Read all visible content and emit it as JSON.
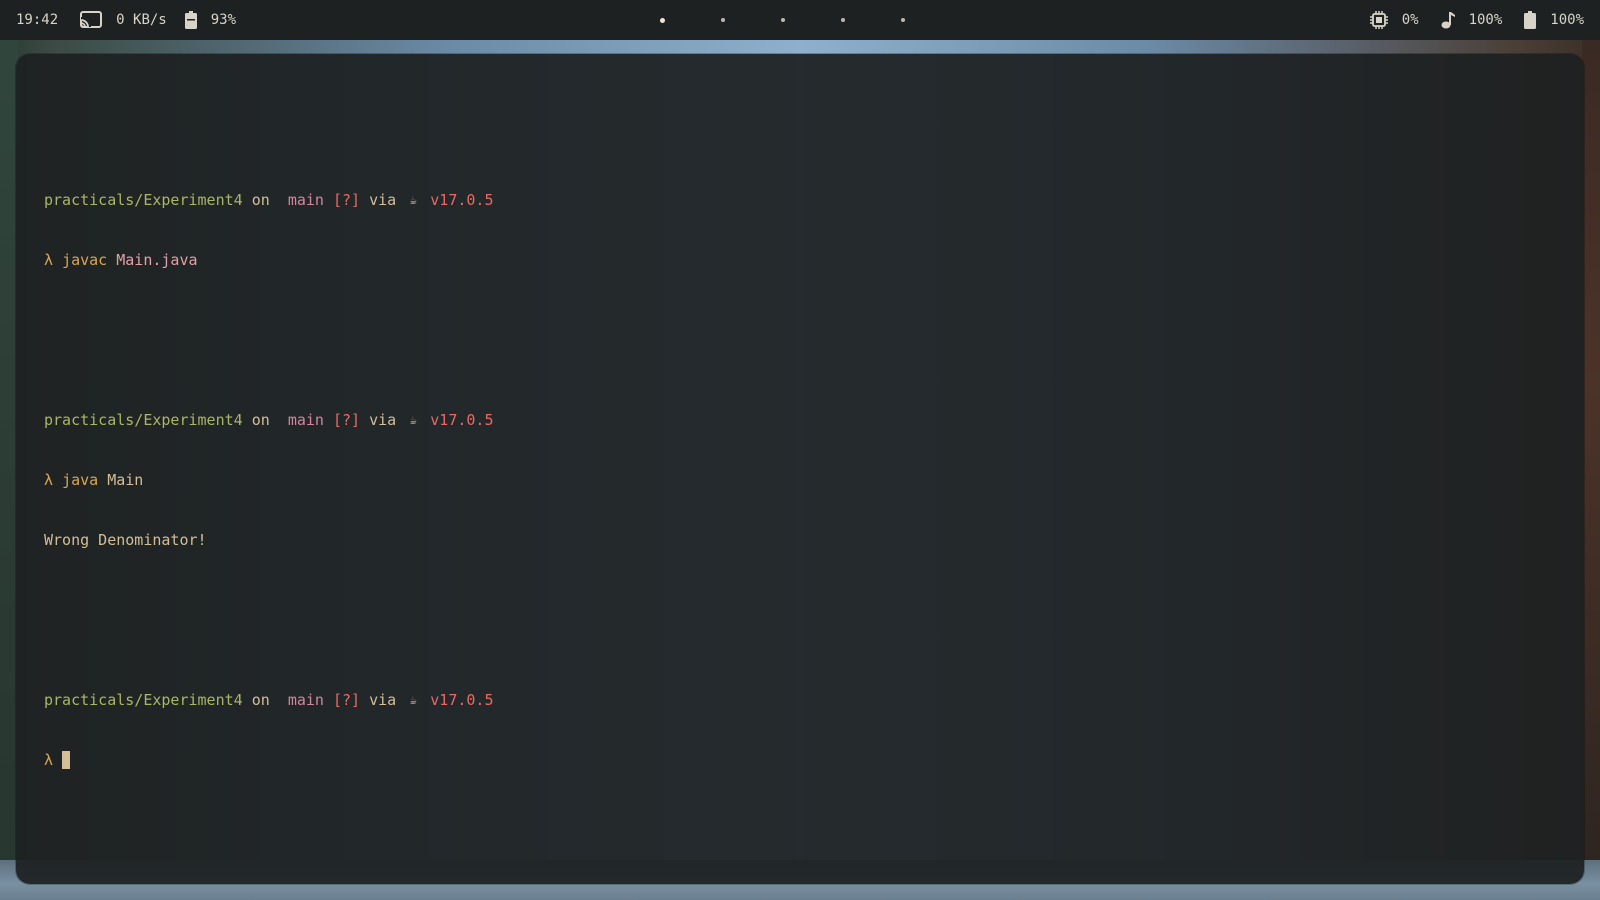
{
  "topbar": {
    "clock": "19:42",
    "network_speed": "0 KB/s",
    "battery_left": "93%",
    "workspaces": [
      {
        "active": true
      },
      {
        "active": false
      },
      {
        "active": false
      },
      {
        "active": false
      },
      {
        "active": false
      }
    ],
    "cpu": "0%",
    "volume": "100%",
    "battery_right": "100%"
  },
  "terminal": {
    "prompt": {
      "path": "practicals/Experiment4",
      "on": "on",
      "branch_icon": "",
      "branch": "main",
      "status": "[?]",
      "via": "via",
      "java_icon": "☕",
      "java_version": "v17.0.5",
      "lambda": "λ"
    },
    "blocks": [
      {
        "cmd": "javac",
        "arg": "Main.java",
        "output": ""
      },
      {
        "cmd": "java",
        "arg": "Main",
        "output": "Wrong Denominator!"
      },
      {
        "cmd": "",
        "arg": "",
        "output": ""
      }
    ]
  },
  "colors": {
    "bar_bg": "#1e2122",
    "terminal_bg": "#1d2021",
    "path": "#a9b665",
    "branch": "#d3869b",
    "status": "#ea6962",
    "lambda": "#d8a657",
    "fg": "#d4be98"
  }
}
